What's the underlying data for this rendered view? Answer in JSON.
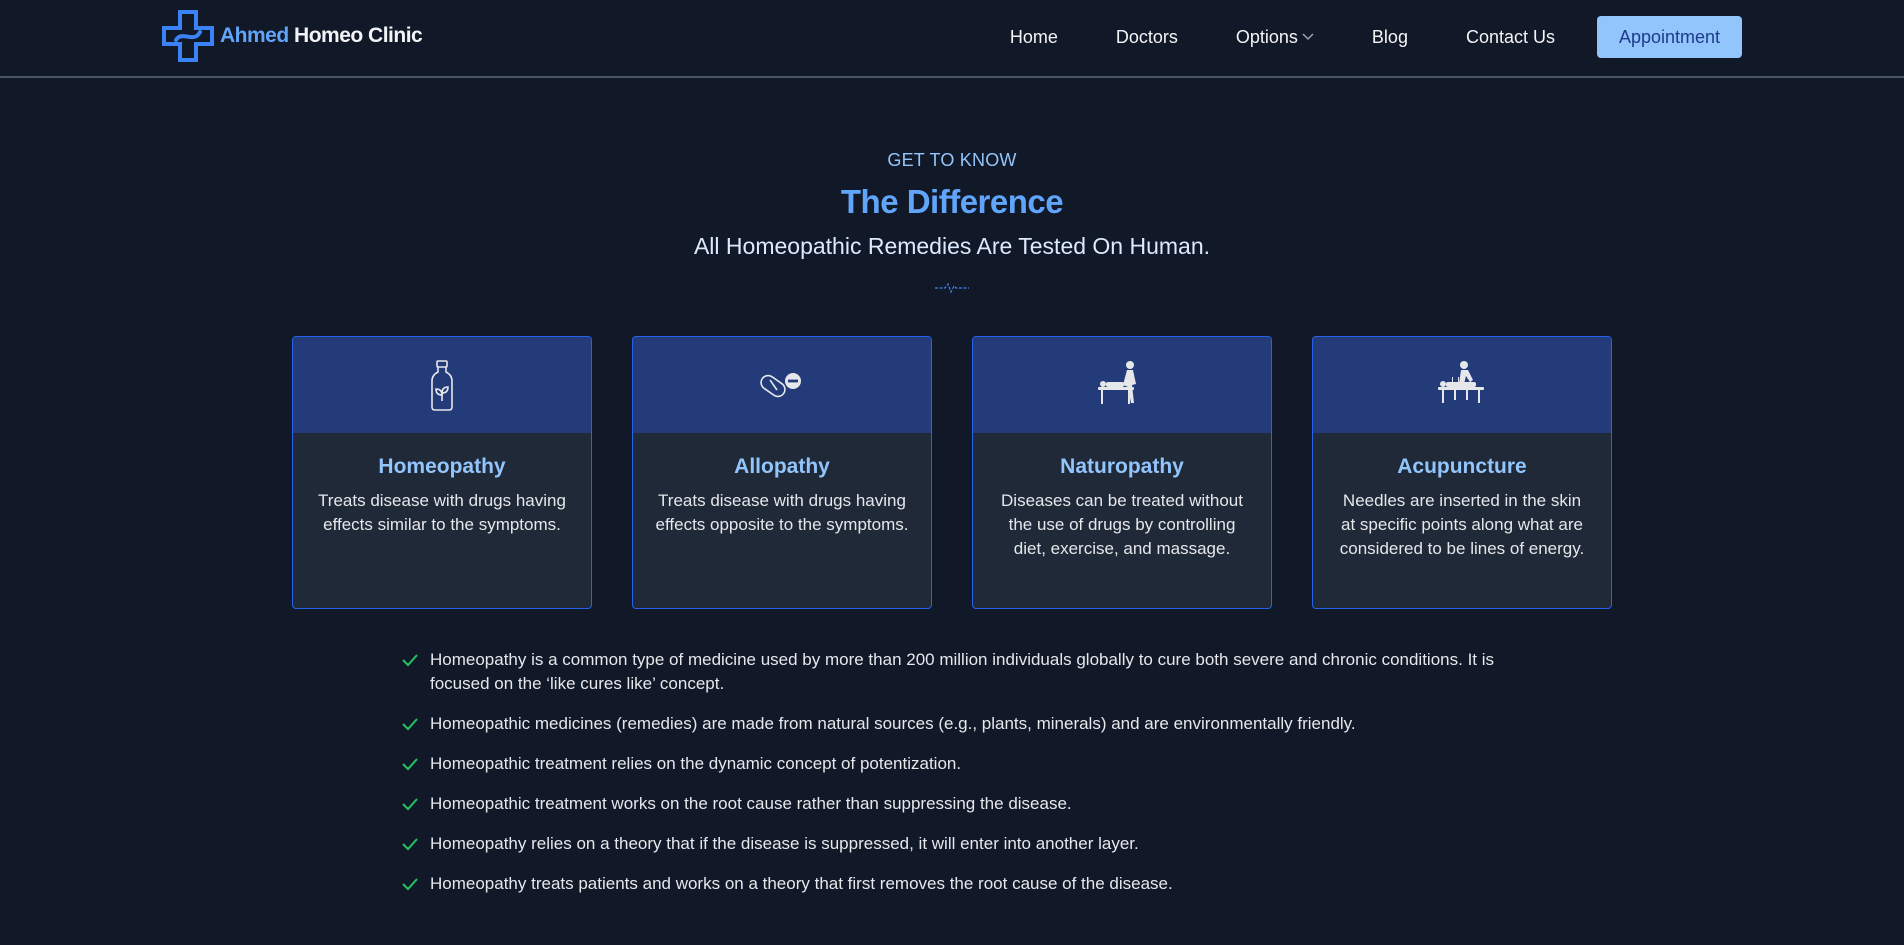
{
  "header": {
    "logo_part1": "Ahmed",
    "logo_part2": "Homeo Clinic",
    "nav": [
      "Home",
      "Doctors",
      "Options",
      "Blog",
      "Contact Us"
    ],
    "appointment_label": "Appointment"
  },
  "hero": {
    "eyebrow": "GET TO KNOW",
    "title": "The Difference",
    "subtitle": "All Homeopathic Remedies Are Tested On Human."
  },
  "cards": [
    {
      "icon": "medicine-bottle-icon",
      "title": "Homeopathy",
      "desc": "Treats disease with drugs having effects similar to the symptoms."
    },
    {
      "icon": "pills-icon",
      "title": "Allopathy",
      "desc": "Treats disease with drugs having effects opposite to the symptoms."
    },
    {
      "icon": "massage-therapy-icon",
      "title": "Naturopathy",
      "desc": "Diseases can be treated without the use of drugs by controlling diet, exercise, and massage."
    },
    {
      "icon": "acupuncture-icon",
      "title": "Acupuncture",
      "desc": "Needles are inserted in the skin at specific points along what are considered to be lines of energy."
    }
  ],
  "checklist": [
    "Homeopathy is a common type of medicine used by more than 200 million individuals globally to cure both severe and chronic conditions. It is focused on the ‘like cures like’ concept.",
    "Homeopathic medicines (remedies) are made from natural sources (e.g., plants, minerals) and are environmentally friendly.",
    "Homeopathic treatment relies on the dynamic concept of potentization.",
    "Homeopathic treatment works on the root cause rather than suppressing the disease.",
    "Homeopathy relies on a theory that if the disease is suppressed, it will enter into another layer.",
    "Homeopathy treats patients and works on a theory that first removes the root cause of the disease."
  ],
  "colors": {
    "background": "#111827",
    "accent": "#60a5fa",
    "button": "#93c5fd",
    "card_top": "#243b7a",
    "card_body": "#1f2937",
    "check": "#22c55e"
  }
}
